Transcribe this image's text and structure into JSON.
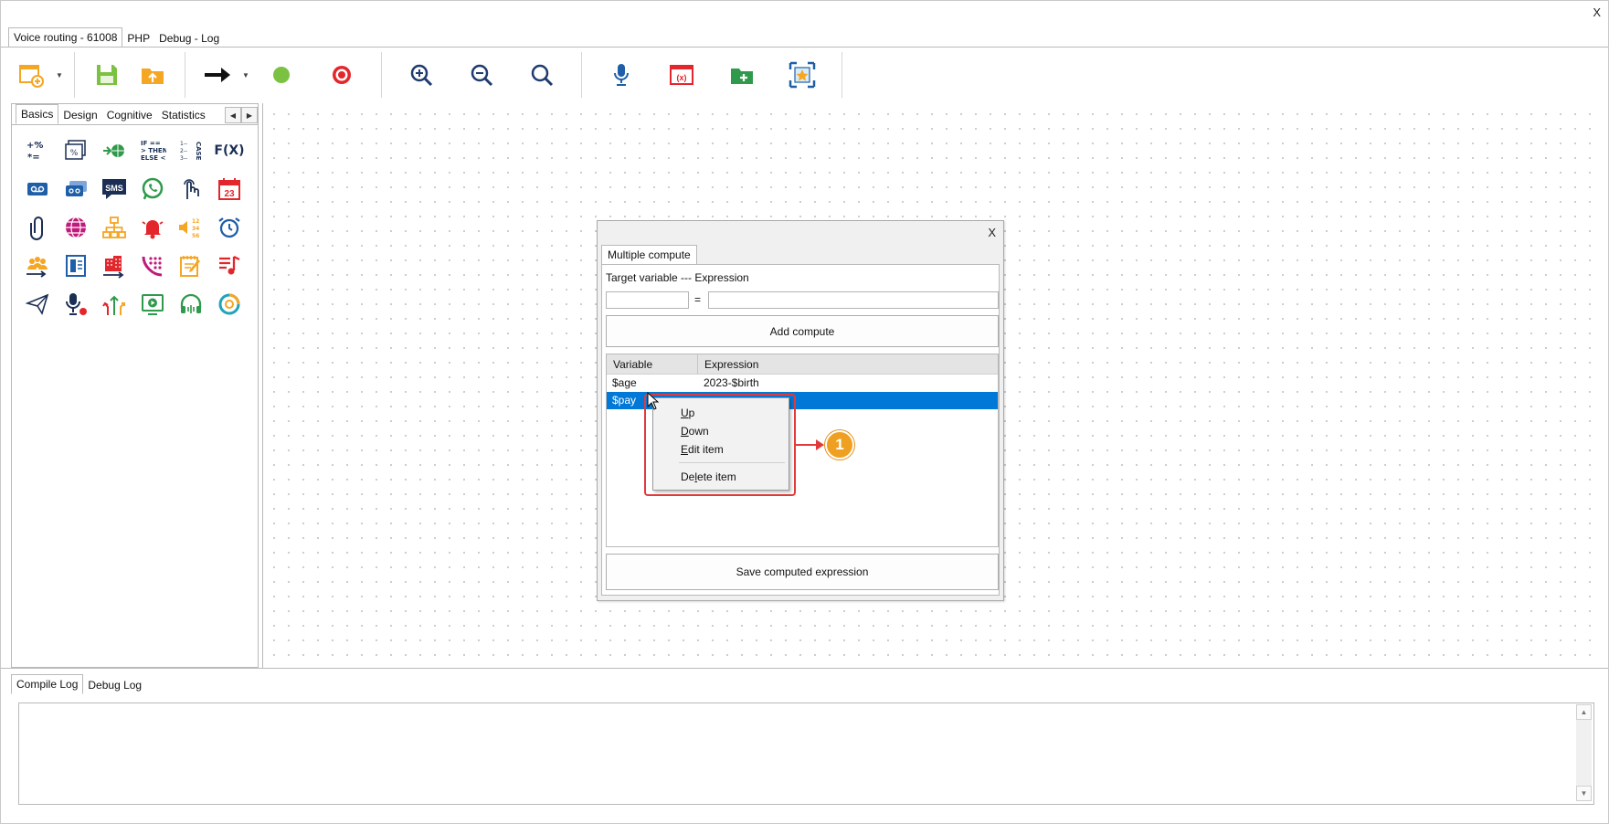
{
  "window": {
    "close_label": "X"
  },
  "top_tabs": [
    {
      "label": "Voice routing - 61008",
      "active": true
    },
    {
      "label": "PHP",
      "active": false
    },
    {
      "label": "Debug - Log",
      "active": false
    }
  ],
  "toolbar": {
    "icons": [
      "new-flow-icon",
      "save-icon",
      "upload-icon",
      "arrow-right-icon",
      "green-dot-icon",
      "record-icon",
      "zoom-in-icon",
      "zoom-out-icon",
      "zoom-reset-icon",
      "microphone-icon",
      "variable-icon",
      "add-folder-icon",
      "favorite-select-icon"
    ]
  },
  "palette": {
    "tabs": [
      {
        "label": "Basics",
        "active": true
      },
      {
        "label": "Design",
        "active": false
      },
      {
        "label": "Cognitive",
        "active": false
      },
      {
        "label": "Statistics",
        "active": false
      }
    ],
    "icons": [
      "math-operators-icon",
      "percent-stack-icon",
      "globe-link-icon",
      "if-then-else-icon",
      "case-icon",
      "fx-icon",
      "voicemail-icon",
      "voicemail-stack-icon",
      "sms-icon",
      "whatsapp-icon",
      "touch-finger-icon",
      "calendar-icon",
      "paperclip-icon",
      "web-icon",
      "org-chart-icon",
      "bell-icon",
      "speak-numbers-icon",
      "alarm-clock-icon",
      "queue-agents-icon",
      "phone-book-icon",
      "building-transfer-icon",
      "dialpad-icon",
      "note-edit-icon",
      "music-list-icon",
      "send-icon",
      "record-mic-icon",
      "route-split-icon",
      "play-media-icon",
      "headset-icon",
      "recycle-icon"
    ],
    "labels": {
      "fx": "F(X)",
      "sms": "SMS",
      "calendar_day": "23",
      "if_then_else": "IF == > THEN ELSE <",
      "case": "CASE",
      "numbers": "12 34 56"
    }
  },
  "dialog": {
    "close_label": "X",
    "tab_label": "Multiple compute",
    "field_label": "Target variable --- Expression",
    "equals": "=",
    "target_value": "",
    "expression_value": "",
    "add_button": "Add compute",
    "grid": {
      "headers": [
        "Variable",
        "Expression"
      ],
      "rows": [
        {
          "variable": "$age",
          "expression": "2023-$birth",
          "selected": false
        },
        {
          "variable": "$pay",
          "expression": "",
          "selected": true
        }
      ]
    },
    "save_button": "Save computed expression"
  },
  "context_menu": {
    "items": [
      {
        "label": "Up",
        "mnemonic": "U"
      },
      {
        "label": "Down",
        "mnemonic": "D"
      },
      {
        "label": "Edit item",
        "mnemonic": "E"
      },
      {
        "label": "Delete item",
        "mnemonic": "l"
      }
    ]
  },
  "callout": {
    "number": "1",
    "color": "#f0a020",
    "border_color": "#e23a3a"
  },
  "log": {
    "tabs": [
      {
        "label": "Compile Log",
        "active": true
      },
      {
        "label": "Debug Log",
        "active": false
      }
    ],
    "content": ""
  },
  "colors": {
    "selection": "#0078d7",
    "orange": "#f5a623",
    "green": "#7cc242",
    "red": "#e3262c",
    "blue": "#1f5fa8",
    "teal": "#20a4b8"
  }
}
